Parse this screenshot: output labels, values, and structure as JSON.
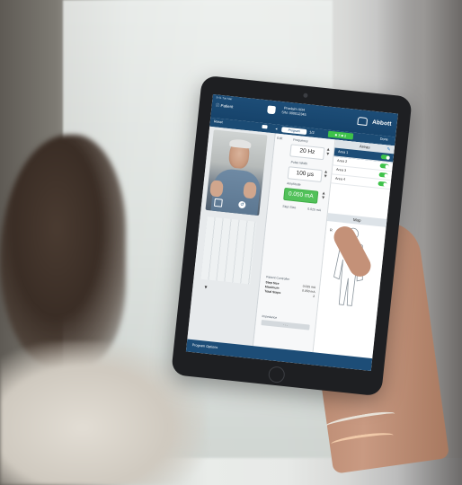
{
  "app": {
    "patient_link": "Patient",
    "device_name": "Proclaim XR4",
    "device_serial": "S/N: 000012345",
    "brand": "Abbott",
    "status_time": "9:41 Tue Mar"
  },
  "toolbar": {
    "reset": "Reset",
    "program": "Program",
    "prev": "◂",
    "next": "1/2",
    "battery": "■ 3 ■ 2",
    "done": "Done"
  },
  "params": {
    "edit_label": "Edit",
    "frequency_label": "Frequency",
    "frequency_value": "20 Hz",
    "pulse_width_label": "Pulse Width",
    "pulse_width_value": "100 µs",
    "amplitude_label": "Amplitude",
    "amplitude_value": "0.050 mA",
    "step_size_label": "Step Size",
    "step_size_value": "0.025 mA"
  },
  "controller": {
    "title": "Patient Controller",
    "rows": [
      {
        "label": "Step Size",
        "value": "0.025 mA"
      },
      {
        "label": "Maximum",
        "value": "0.050 mA"
      },
      {
        "label": "Total Steps",
        "value": "2"
      }
    ]
  },
  "impedance": {
    "label": "Impedance",
    "value": "- - -"
  },
  "areas": {
    "title": "Areas",
    "items": [
      "Area 1",
      "Area 2",
      "Area 3",
      "Area 4"
    ]
  },
  "map": {
    "title": "Map",
    "side": "R"
  },
  "bottom": {
    "program_options": "Program Options"
  },
  "colors": {
    "header_blue": "#1d4d77",
    "accent_green": "#52c15a",
    "toggle_green": "#3ec24a"
  }
}
